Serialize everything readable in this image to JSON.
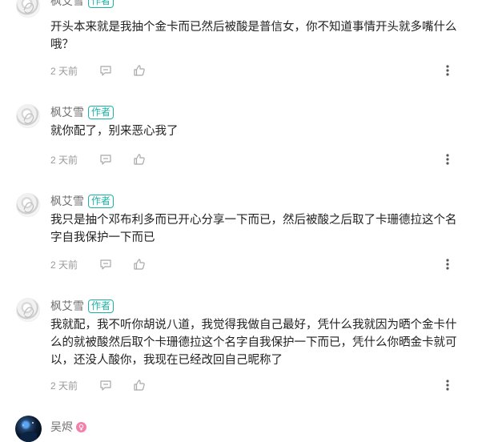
{
  "colors": {
    "accent": "#19b3a6",
    "muted_text": "#9a9a9a",
    "body_text": "#222222",
    "name_text": "#707070"
  },
  "icons": {
    "reply": "comment-bubble-icon",
    "like": "thumbs-up-icon",
    "more": "vertical-dots-icon",
    "gender": "female-badge-icon"
  },
  "comments": [
    {
      "author": "枫艾雪",
      "badge": "作者",
      "text": "开头本来就是我抽个金卡而已然后被酸是普信女，你不知道事情开头就多嘴什么哦？",
      "time": "2 天前"
    },
    {
      "author": "枫艾雪",
      "badge": "作者",
      "text": "就你配了，别来恶心我了",
      "time": "2 天前"
    },
    {
      "author": "枫艾雪",
      "badge": "作者",
      "text": "我只是抽个邓布利多而已开心分享一下而已，然后被酸之后取了卡珊德拉这个名字自我保护一下而已",
      "time": "2 天前"
    },
    {
      "author": "枫艾雪",
      "badge": "作者",
      "text": "我就配，我不听你胡说八道，我觉得我做自己最好，凭什么我就因为晒个金卡什么的就被酸然后取个卡珊德拉这个名字自我保护一下而已，凭什么你晒金卡就可以，还没人酸你，我现在已经改回自己昵称了",
      "time": "2 天前"
    }
  ],
  "next_comment": {
    "author": "吴烬"
  }
}
